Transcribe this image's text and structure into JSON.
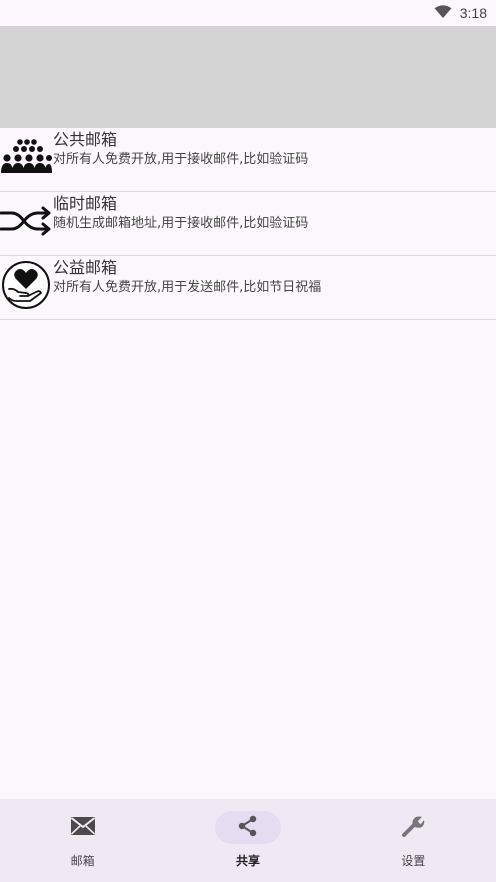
{
  "status_bar": {
    "time": "3:18",
    "icons": [
      "wifi-icon"
    ]
  },
  "mailbox_list": [
    {
      "title": "公共邮箱",
      "description": "对所有人免费开放,用于接收邮件,比如验证码",
      "icon": "crowd-icon"
    },
    {
      "title": "临时邮箱",
      "description": "随机生成邮箱地址,用于接收邮件,比如验证码",
      "icon": "shuffle-icon"
    },
    {
      "title": "公益邮箱",
      "description": "对所有人免费开放,用于发送邮件,比如节日祝福",
      "icon": "heart-hand-icon"
    }
  ],
  "bottom_nav": {
    "items": [
      {
        "label": "邮箱",
        "icon": "mail-icon"
      },
      {
        "label": "共享",
        "icon": "share-icon"
      },
      {
        "label": "设置",
        "icon": "wrench-icon"
      }
    ],
    "selected": "共享"
  },
  "colors": {
    "background": "#fcf7fd",
    "banner": "#d4d4d4",
    "nav_background": "#f0e9f4",
    "nav_active_pill": "#e6dcf2"
  }
}
